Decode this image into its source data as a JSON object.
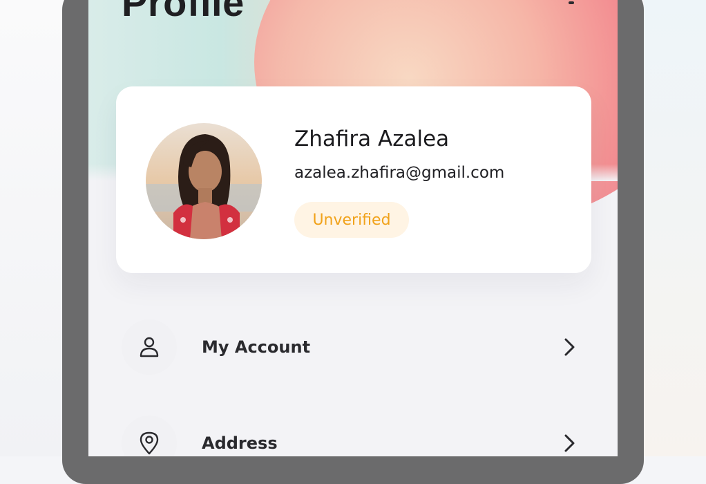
{
  "header": {
    "title": "Profile"
  },
  "profile": {
    "name": "Zhafira Azalea",
    "email": "azalea.zhafira@gmail.com",
    "status": "Unverified"
  },
  "menu": {
    "items": [
      {
        "label": "My Account",
        "icon": "user-icon"
      },
      {
        "label": "Address",
        "icon": "location-pin-icon"
      }
    ]
  },
  "colors": {
    "status_text": "#f1a21a",
    "status_bg": "#fff4e4",
    "header_accent": "#f1707d"
  }
}
